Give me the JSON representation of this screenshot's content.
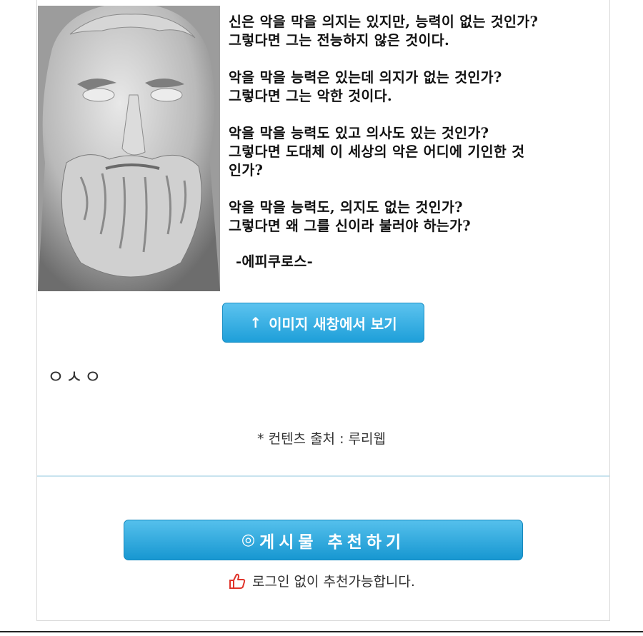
{
  "quote": {
    "paragraphs": [
      [
        "신은 악을 막을 의지는 있지만, 능력이 없는 것인가?",
        "그렇다면 그는 전능하지 않은 것이다."
      ],
      [
        "악을 막을 능력은 있는데 의지가 없는 것인가?",
        "그렇다면 그는 악한 것이다."
      ],
      [
        "악을 막을 능력도 있고 의사도 있는 것인가?",
        "그렇다면 도대체 이 세상의 악은 어디에 기인한 것",
        "인가?"
      ],
      [
        "악을 막을 능력도, 의지도 없는 것인가?",
        "그렇다면 왜 그를 신이라 불러야 하는가?"
      ]
    ],
    "author": "-에피쿠로스-"
  },
  "view_button": {
    "icon": "up-arrow-icon",
    "arrow": "↑",
    "label": "이미지 새창에서 보기"
  },
  "comment": "ㅇㅅㅇ",
  "source": "* 컨텐츠 출처 : 루리웹",
  "recommend_button": {
    "icon": "target-icon",
    "symbol": "◎",
    "label": "게시물 추천하기"
  },
  "recommend_note": {
    "icon": "thumbs-up-icon",
    "text": "로그인 없이 추천가능합니다."
  },
  "colors": {
    "button_top": "#5cc3ef",
    "button_bottom": "#1e9fd9",
    "divider": "#c8e3ef",
    "thumb": "#e0342b"
  }
}
